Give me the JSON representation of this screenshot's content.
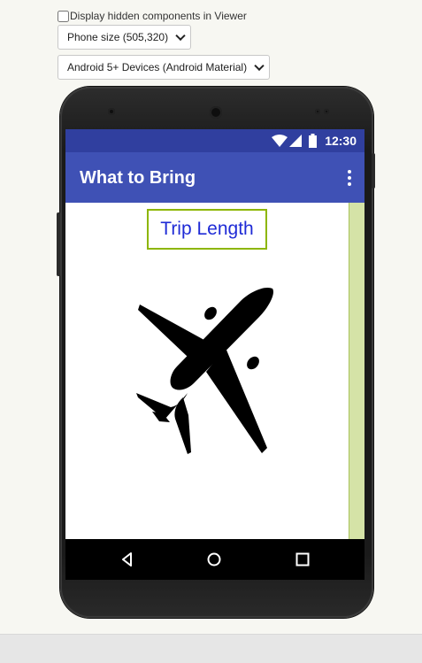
{
  "viewer_controls": {
    "hidden_components_label": "Display hidden components in Viewer",
    "hidden_components_checked": false,
    "phone_size_selected": "Phone size (505,320)",
    "theme_selected": "Android 5+ Devices (Android Material)"
  },
  "status_bar": {
    "time": "12:30",
    "icons": [
      "wifi-icon",
      "signal-icon",
      "battery-icon"
    ]
  },
  "app_bar": {
    "title": "What to Bring",
    "menu_icon": "overflow-menu-icon"
  },
  "content": {
    "trip_button_label": "Trip Length",
    "image_icon": "airplane-icon"
  },
  "nav_bar": {
    "icons": [
      "back-icon",
      "home-icon",
      "recents-icon"
    ]
  },
  "colors": {
    "status_bar": "#303f9f",
    "app_bar": "#3f51b5",
    "button_border": "#8db600",
    "button_text": "#1f2bd6",
    "scroll_strip": "#d5e3a7"
  }
}
